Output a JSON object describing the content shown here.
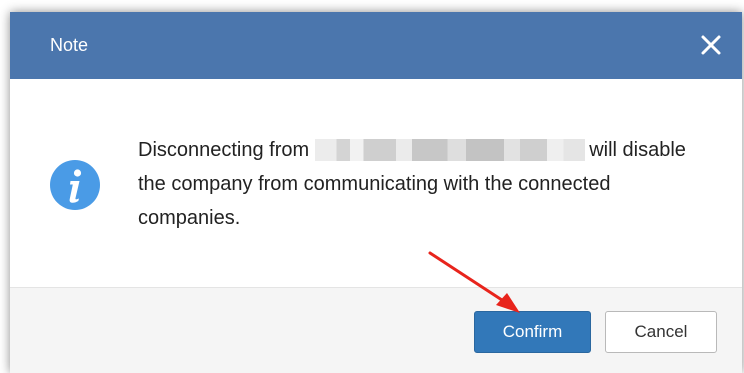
{
  "dialog": {
    "title": "Note",
    "close_icon": "close-icon",
    "info_icon": "info-icon",
    "message": {
      "prefix": "Disconnecting from",
      "suffix": "will disable the company from communicating with the connected companies."
    },
    "buttons": {
      "confirm_label": "Confirm",
      "cancel_label": "Cancel"
    }
  },
  "annotation": {
    "arrow_color": "#e8241c",
    "target": "confirm-button"
  },
  "colors": {
    "titlebar": "#4b76ad",
    "confirm": "#3278b9",
    "info_icon": "#4a9be6"
  }
}
